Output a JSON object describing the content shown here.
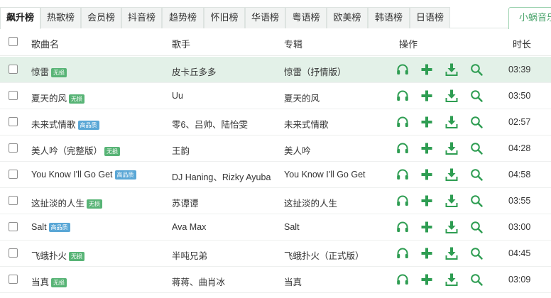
{
  "tabs": [
    "飙升榜",
    "热歌榜",
    "会员榜",
    "抖音榜",
    "趋势榜",
    "怀旧榜",
    "华语榜",
    "粤语榜",
    "欧美榜",
    "韩语榜",
    "日语榜"
  ],
  "active_tab": "飙升榜",
  "right_tab_label": "小蜗音乐",
  "columns": {
    "song": "歌曲名",
    "artist": "歌手",
    "album": "专辑",
    "actions": "操作",
    "duration": "时长"
  },
  "accent_color": "#2e9d52",
  "badge_colors": {
    "green": "#58b476",
    "blue": "#5aa7d6"
  },
  "songs": [
    {
      "title": "惊雷",
      "badge": "无损",
      "badge_color": "green",
      "artist": "皮卡丘多多",
      "album": "惊雷（抒情版）",
      "duration": "03:39",
      "selected": true
    },
    {
      "title": "夏天的风",
      "badge": "无损",
      "badge_color": "green",
      "artist": "Uu",
      "album": "夏天的风",
      "duration": "03:50",
      "selected": false
    },
    {
      "title": "未来式情歌",
      "badge": "高品质",
      "badge_color": "blue",
      "artist": "零6、吕帅、陆怡雯",
      "album": "未来式情歌",
      "duration": "02:57",
      "selected": false
    },
    {
      "title": "美人吟（完整版）",
      "badge": "无损",
      "badge_color": "green",
      "artist": "王韵",
      "album": "美人吟",
      "duration": "04:28",
      "selected": false
    },
    {
      "title": "You Know I'll Go Get",
      "badge": "高品质",
      "badge_color": "blue",
      "artist": "DJ Haning、Rizky Ayuba",
      "album": "You Know I'll Go Get",
      "duration": "04:58",
      "selected": false
    },
    {
      "title": "这扯淡的人生",
      "badge": "无损",
      "badge_color": "green",
      "artist": "苏谭谭",
      "album": "这扯淡的人生",
      "duration": "03:55",
      "selected": false
    },
    {
      "title": "Salt",
      "badge": "高品质",
      "badge_color": "blue",
      "artist": "Ava Max",
      "album": "Salt",
      "duration": "03:00",
      "selected": false
    },
    {
      "title": "飞蛾扑火",
      "badge": "无损",
      "badge_color": "green",
      "artist": "半吨兄弟",
      "album": "飞蛾扑火（正式版）",
      "duration": "04:45",
      "selected": false
    },
    {
      "title": "当真",
      "badge": "无损",
      "badge_color": "green",
      "artist": "蒋蒋、曲肖冰",
      "album": "当真",
      "duration": "03:09",
      "selected": false
    }
  ],
  "row_actions": [
    "headphones-icon",
    "plus-icon",
    "download-icon",
    "search-icon"
  ]
}
